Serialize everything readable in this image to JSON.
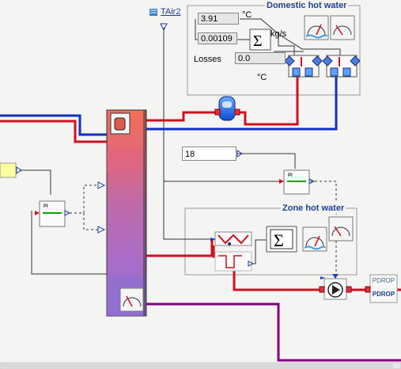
{
  "domestic_hot_water": {
    "title": "Domestic hot water",
    "temperature_value": "3.91",
    "temperature_unit": "°C",
    "flow_value": "0.00109",
    "flow_unit": "kg/s",
    "losses_label": "Losses",
    "losses_value": "0.0",
    "losses_unit": "°C"
  },
  "zone_hot_water": {
    "title": "Zone hot water"
  },
  "sensor": {
    "label": "TAir2"
  },
  "setpoint": {
    "value": "18"
  },
  "controllers": {
    "left_label": "PI",
    "right_label": "PI"
  },
  "pressure_drop": {
    "label_top": "PDROP",
    "label_bottom": "PDROP"
  },
  "colors": {
    "supply_pipe": "#d01020",
    "return_pipe": "#1030c0",
    "purple_pipe": "#800080",
    "tank_top": "#ee6f5b",
    "tank_bottom": "#9c6cc8",
    "signal_line": "#333333"
  }
}
